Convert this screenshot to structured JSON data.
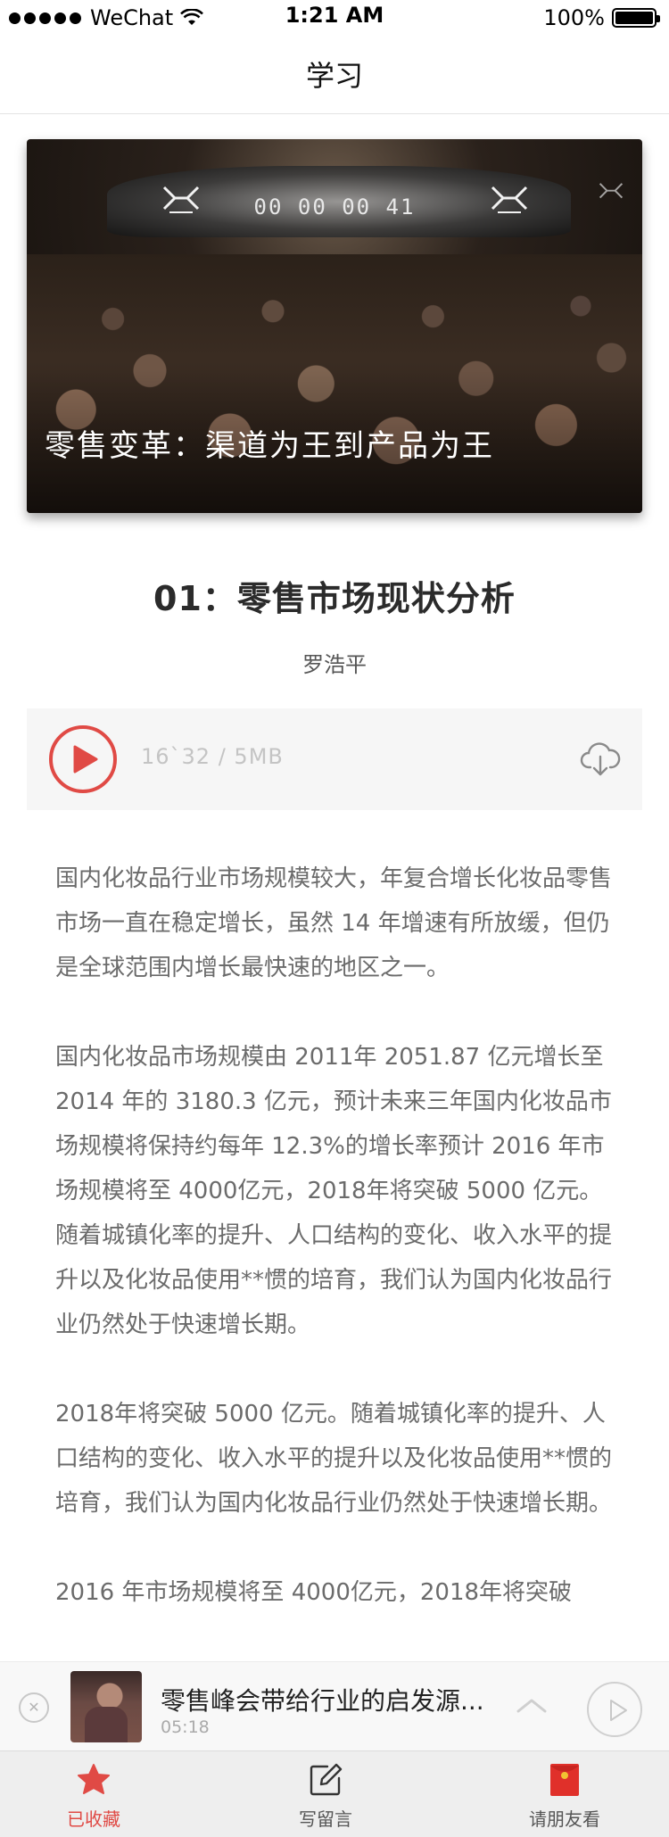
{
  "status_bar": {
    "carrier": "WeChat",
    "time": "1:21 AM",
    "battery": "100%"
  },
  "nav": {
    "title": "学习"
  },
  "hero": {
    "countdown": "00 00 00 41",
    "caption": "零售变革：渠道为王到产品为王"
  },
  "lesson": {
    "title": "01：零售市场现状分析",
    "author": "罗浩平"
  },
  "audio": {
    "meta": "16`32 / 5MB"
  },
  "article": {
    "paragraphs": [
      "国内化妆品行业市场规模较大，年复合增长化妆品零售市场一直在稳定增长，虽然 14 年增速有所放缓，但仍是全球范围内增长最快速的地区之一。",
      "国内化妆品市场规模由 2011年 2051.87 亿元增长至 2014 年的 3180.3 亿元，预计未来三年国内化妆品市场规模将保持约每年 12.3%的增长率预计 2016 年市场规模将至 4000亿元，2018年将突破 5000 亿元。随着城镇化率的提升、人口结构的变化、收入水平的提升以及化妆品使用**惯的培育，我们认为国内化妆品行业仍然处于快速增长期。",
      "2018年将突破 5000 亿元。随着城镇化率的提升、人口结构的变化、收入水平的提升以及化妆品使用**惯的培育，我们认为国内化妆品行业仍然处于快速增长期。",
      "2016 年市场规模将至 4000亿元，2018年将突破"
    ]
  },
  "mini_player": {
    "title": "零售峰会带给行业的启发源...",
    "time": "05:18"
  },
  "tab_bar": {
    "favorite_label": "已收藏",
    "comment_label": "写留言",
    "invite_label": "请朋友看"
  },
  "colors": {
    "accent": "#e04a45",
    "body_text": "#6b6b6b",
    "audio_card_bg": "#f6f6f6",
    "tab_bar_bg": "#eeeeee"
  }
}
